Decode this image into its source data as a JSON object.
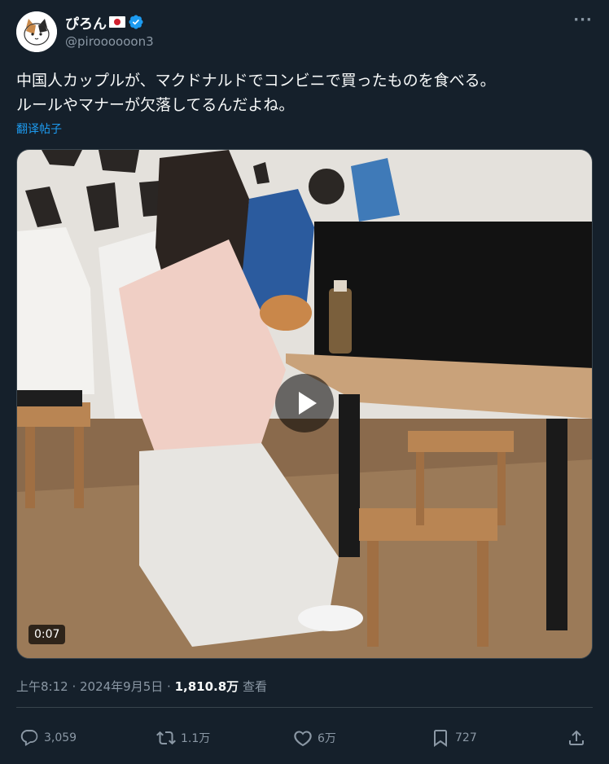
{
  "user": {
    "display_name": "ぴろん",
    "handle": "@piroooooon3",
    "verified": true,
    "flag": "japan-flag"
  },
  "tweet": {
    "lines": [
      "中国人カップルが、マクドナルドでコンビニで買ったものを食べる。",
      "ルールやマナーが欠落してるんだよね。"
    ],
    "translate_label": "翻译帖子"
  },
  "media": {
    "duration": "0:07"
  },
  "meta": {
    "time": "上午8:12",
    "separator": " · ",
    "date": "2024年9月5日",
    "views": "1,810.8万",
    "views_label": " 查看"
  },
  "actions": {
    "replies": "3,059",
    "reposts": "1.1万",
    "likes": "6万",
    "bookmarks": "727"
  },
  "colors": {
    "background": "#15202b",
    "text": "#f7f9f9",
    "secondary": "#8b98a5",
    "accent": "#1d9bf0",
    "border": "#38444d"
  }
}
